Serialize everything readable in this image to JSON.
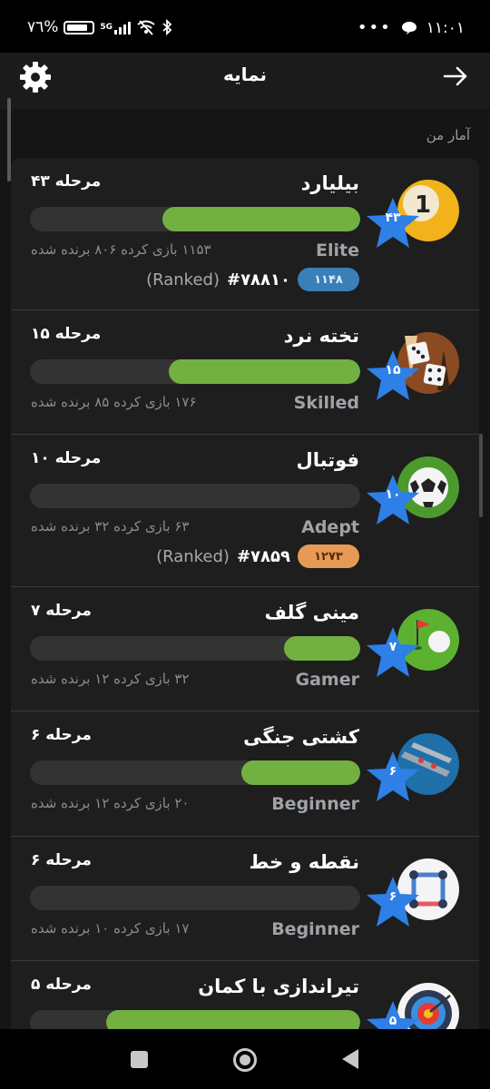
{
  "status_bar": {
    "battery_text": "٧٦%",
    "network": "5G",
    "time": "۱۱:۰۱",
    "more": "•••"
  },
  "app_bar": {
    "title": "نمایه",
    "settings_icon": "gear-icon",
    "back_icon": "arrow-right-icon"
  },
  "section_label": "آمار من",
  "games": [
    {
      "name": "بیلیارد",
      "level": "مرحله ۴۳",
      "star_level": "۴۳",
      "progress": 0.6,
      "rank_title": "Elite",
      "stats": "۱۱۵۳ بازی کرده  ۸۰۶ برنده شده",
      "ranked": {
        "number": "#۷۸۸۱۰",
        "pill": "۱۱۴۸",
        "label": "(Ranked)",
        "pill_color": "blue"
      },
      "icon": "billiard-ball-icon"
    },
    {
      "name": "تخته نرد",
      "level": "مرحله ۱۵",
      "star_level": "۱۵",
      "progress": 0.58,
      "rank_title": "Skilled",
      "stats": "۱۷۶ بازی کرده  ۸۵ برنده شده",
      "icon": "backgammon-dice-icon"
    },
    {
      "name": "فوتبال",
      "level": "مرحله ۱۰",
      "star_level": "۱۰",
      "progress": 0.0,
      "rank_title": "Adept",
      "stats": "۶۳ بازی کرده  ۳۲ برنده شده",
      "ranked": {
        "number": "#۷۸۵۹",
        "pill": "۱۲۷۳",
        "label": "(Ranked)",
        "pill_color": "orange"
      },
      "icon": "soccer-ball-icon"
    },
    {
      "name": "مینی گلف",
      "level": "مرحله ۷",
      "star_level": "۷",
      "progress": 0.23,
      "rank_title": "Gamer",
      "stats": "۳۲ بازی کرده  ۱۲ برنده شده",
      "icon": "golf-flag-icon"
    },
    {
      "name": "کشتی جنگی",
      "level": "مرحله ۶",
      "star_level": "۶",
      "progress": 0.36,
      "rank_title": "Beginner",
      "stats": "۲۰ بازی کرده  ۱۲ برنده شده",
      "icon": "battleship-icon"
    },
    {
      "name": "نقطه و خط",
      "level": "مرحله ۶",
      "star_level": "۶",
      "progress": 0.0,
      "rank_title": "Beginner",
      "stats": "۱۷ بازی کرده  ۱۰ برنده شده",
      "icon": "dots-and-lines-icon"
    },
    {
      "name": "تیراندازی با کمان",
      "level": "مرحله ۵",
      "star_level": "۵",
      "progress": 0.77,
      "rank_title": "",
      "stats": "",
      "icon": "archery-target-icon"
    }
  ],
  "colors": {
    "progress_fill": "#72b041",
    "progress_track": "#333333",
    "star": "#2e7fe6",
    "pill_blue": "#3a7fb8",
    "pill_orange": "#e69a55"
  },
  "nav_bar": {
    "recents_icon": "square-icon",
    "home_icon": "circle-icon",
    "back_icon": "triangle-back-icon"
  }
}
